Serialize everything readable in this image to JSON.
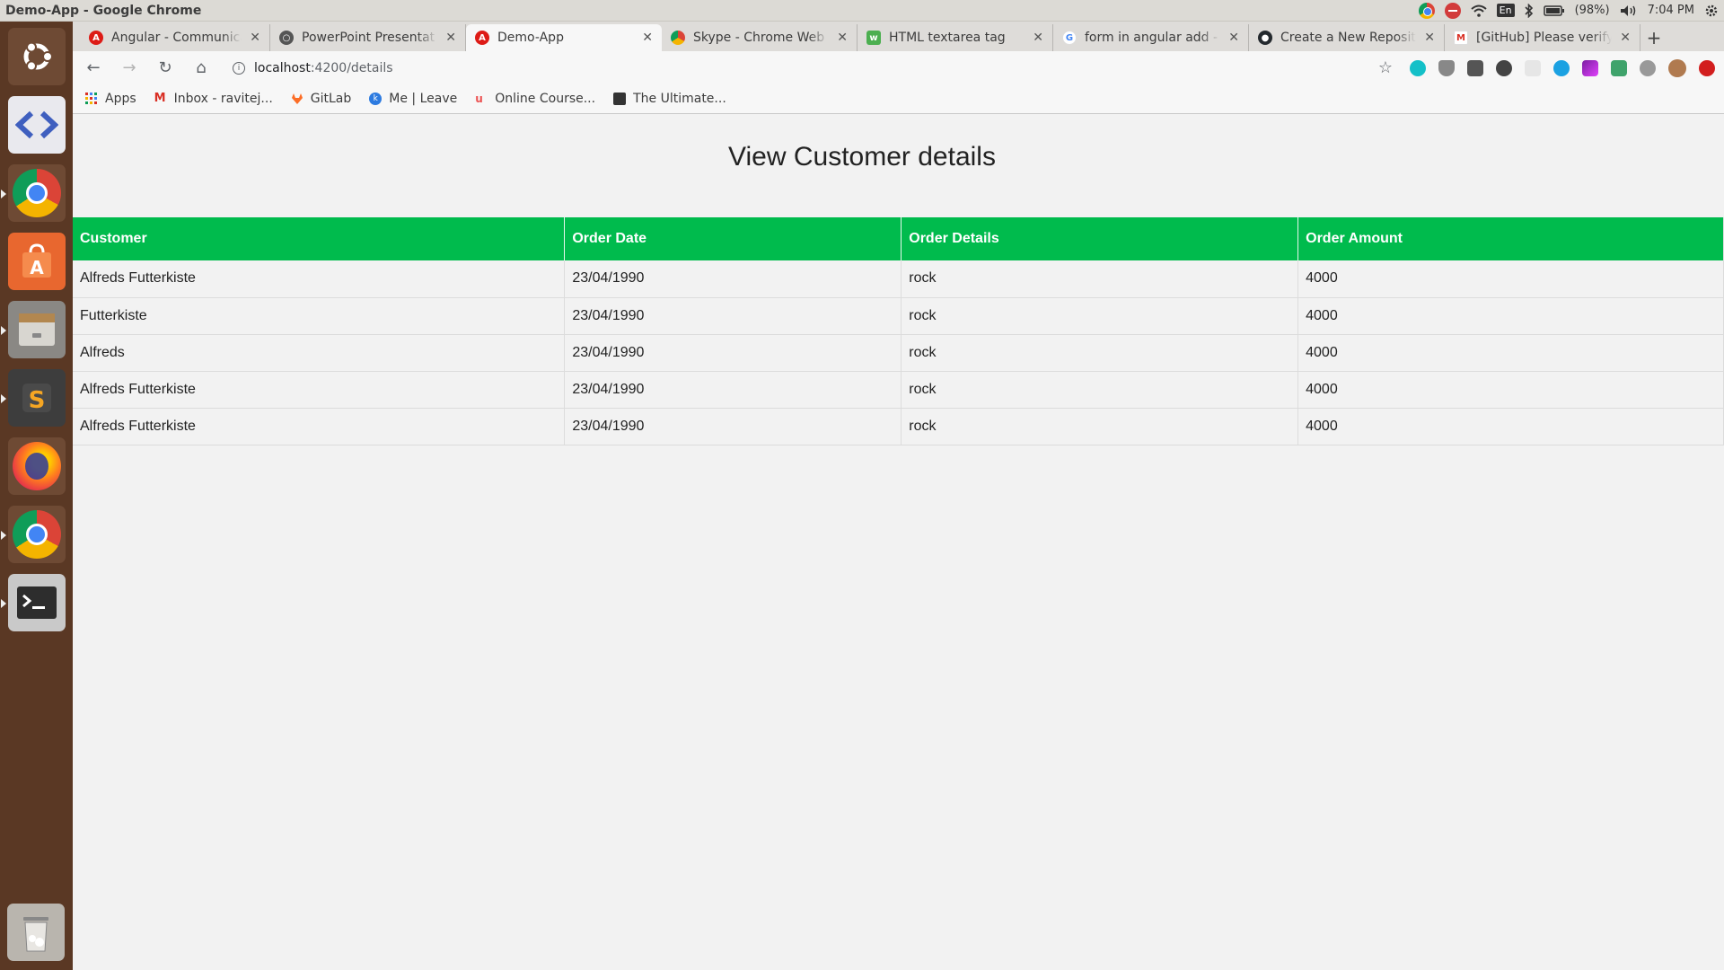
{
  "window": {
    "title": "Demo-App - Google Chrome"
  },
  "system_tray": {
    "battery": "(98%)",
    "time": "7:04 PM",
    "keyboard": "En"
  },
  "tabs": [
    {
      "label": "Angular - Communicat",
      "favicon": "angular-icon",
      "active": false
    },
    {
      "label": "PowerPoint Presentat",
      "favicon": "globe-icon",
      "active": false
    },
    {
      "label": "Demo-App",
      "favicon": "angular-icon",
      "active": true
    },
    {
      "label": "Skype - Chrome Web St",
      "favicon": "webstore-icon",
      "active": false
    },
    {
      "label": "HTML textarea tag",
      "favicon": "w3schools-icon",
      "active": false
    },
    {
      "label": "form in angular add - G",
      "favicon": "google-icon",
      "active": false
    },
    {
      "label": "Create a New Reposito",
      "favicon": "github-icon",
      "active": false
    },
    {
      "label": "[GitHub] Please verify",
      "favicon": "gmail-icon",
      "active": false
    }
  ],
  "address_bar": {
    "host": "localhost",
    "path": ":4200/details"
  },
  "bookmarks": [
    {
      "label": "Apps",
      "icon": "apps-grid-icon"
    },
    {
      "label": "Inbox - ravitej...",
      "icon": "gmail-icon"
    },
    {
      "label": "GitLab",
      "icon": "gitlab-icon"
    },
    {
      "label": "Me | Leave",
      "icon": "k-icon"
    },
    {
      "label": "Online Course...",
      "icon": "udemy-icon"
    },
    {
      "label": "The Ultimate...",
      "icon": "site-icon"
    }
  ],
  "page": {
    "heading": "View Customer details",
    "table": {
      "columns": [
        "Customer",
        "Order Date",
        "Order Details",
        "Order Amount"
      ],
      "rows": [
        [
          "Alfreds Futterkiste",
          "23/04/1990",
          "rock",
          "4000"
        ],
        [
          "Futterkiste",
          "23/04/1990",
          "rock",
          "4000"
        ],
        [
          "Alfreds",
          "23/04/1990",
          "rock",
          "4000"
        ],
        [
          "Alfreds Futterkiste",
          "23/04/1990",
          "rock",
          "4000"
        ],
        [
          "Alfreds Futterkiste",
          "23/04/1990",
          "rock",
          "4000"
        ]
      ]
    }
  },
  "colors": {
    "table_header": "#00bb4d",
    "launcher": "#5a3824"
  }
}
